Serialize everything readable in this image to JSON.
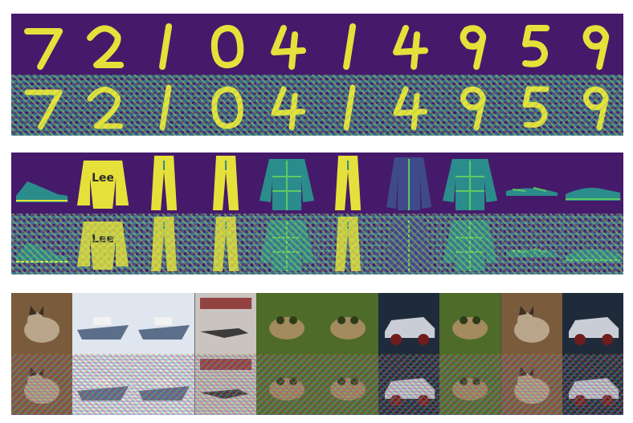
{
  "panels": [
    {
      "name": "mnist-panel",
      "rows": [
        "clean",
        "noisy"
      ],
      "tiles": [
        "7",
        "2",
        "1",
        "0",
        "4",
        "1",
        "4",
        "9",
        "5",
        "9"
      ]
    },
    {
      "name": "fashion-panel",
      "rows": [
        "clean",
        "noisy"
      ],
      "tiles": [
        "shoe-icon",
        "sweatshirt-icon",
        "trousers-icon",
        "trousers-icon",
        "shirt-icon",
        "trousers-icon",
        "coat-icon",
        "shirt-icon",
        "sandal-icon",
        "sneaker-icon"
      ],
      "sweatshirt_text": "Lee"
    },
    {
      "name": "cifar-panel",
      "rows": [
        "clean",
        "noisy"
      ],
      "tiles": [
        "cat",
        "ship",
        "ship",
        "airplane",
        "frog",
        "frog",
        "automobile",
        "frog",
        "cat",
        "automobile"
      ]
    }
  ],
  "colors": {
    "viridis_dark": "#461a6b",
    "viridis_yellow": "#e6e13a",
    "viridis_teal": "#2b8c8c",
    "viridis_green": "#5ec962"
  }
}
